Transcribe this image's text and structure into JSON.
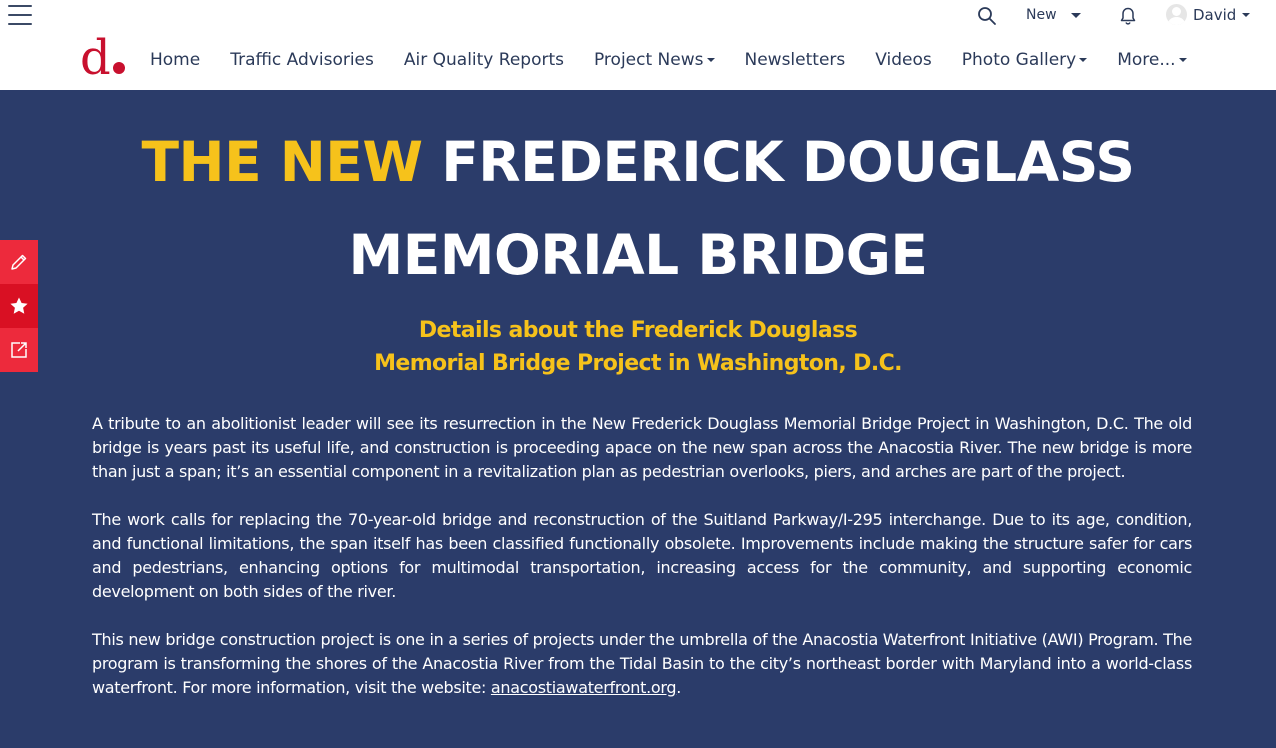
{
  "header": {
    "new_label": "New",
    "user_name": "David"
  },
  "logo": {
    "text": "d"
  },
  "nav": {
    "items": [
      {
        "label": "Home",
        "dropdown": false
      },
      {
        "label": "Traffic Advisories",
        "dropdown": false
      },
      {
        "label": "Air Quality Reports",
        "dropdown": false
      },
      {
        "label": "Project News",
        "dropdown": true
      },
      {
        "label": "Newsletters",
        "dropdown": false
      },
      {
        "label": "Videos",
        "dropdown": false
      },
      {
        "label": "Photo Gallery",
        "dropdown": true
      },
      {
        "label": "More...",
        "dropdown": true
      }
    ]
  },
  "hero": {
    "title_highlight": "THE NEW",
    "title_rest": "FREDERICK DOUGLASS",
    "title_line2": "MEMORIAL BRIDGE",
    "subtitle_line1": "Details about the Frederick Douglass",
    "subtitle_line2": "Memorial Bridge Project in Washington, D.C.",
    "paragraph1": "A tribute to an abolitionist leader will see its resurrection in the New Frederick Douglass Memorial Bridge Project in Washington, D.C. The old bridge is years past its useful life, and construction is proceeding apace on the new span across the Anacostia River. The new bridge is more than just a span; it’s an essential component in a revitalization plan as pedestrian overlooks, piers, and arches are part of the project.",
    "paragraph2": "The work calls for replacing the 70-year-old bridge and reconstruction of the Suitland Parkway/I-295 interchange. Due to its age, condition, and functional limitations, the span itself has been classified functionally obsolete. Improvements include making the structure safer for cars and pedestrians, enhancing options for multimodal transportation, increasing access for the community, and supporting economic development on both sides of the river.",
    "paragraph3_text": "This new bridge construction project is one in a series of projects under the umbrella of the Anacostia Waterfront Initiative (AWI) Program. The program is transforming the shores of the Anacostia River from the Tidal Basin to the city’s northeast border with Maryland into a world-class waterfront. For more information, visit the website: ",
    "paragraph3_link": "anacostiawaterfront.org",
    "paragraph3_end": "."
  },
  "colors": {
    "hero_bg": "#2b3c6a",
    "accent_yellow": "#f6c21b",
    "logo_red": "#c8102e",
    "side_red": "#ed2a3c"
  },
  "icons": {
    "menu": "hamburger-icon",
    "search": "search-icon",
    "notifications": "bell-icon",
    "side_actions": [
      "pencil-icon",
      "star-icon",
      "share-icon"
    ]
  }
}
